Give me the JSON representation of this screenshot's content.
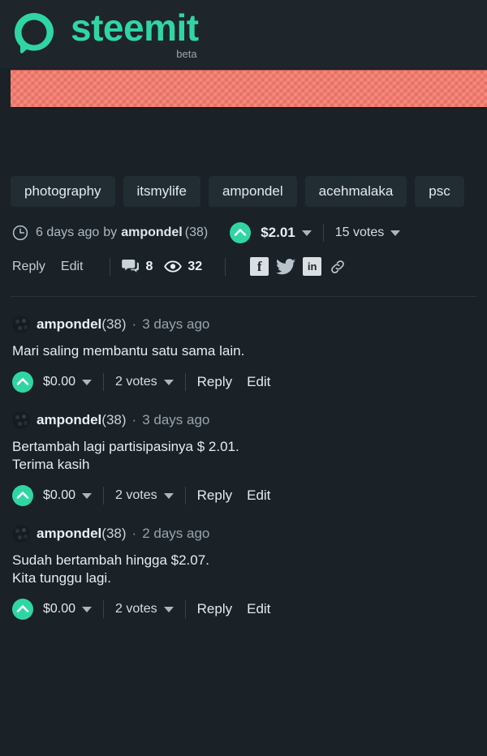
{
  "brand": {
    "name": "steemit",
    "tagline": "beta",
    "logo_icon": "steemit-logo-icon",
    "accent_color": "#2fd6a3",
    "cover_color": "#f4796b"
  },
  "post": {
    "tags": [
      "photography",
      "itsmylife",
      "ampondel",
      "acehmalaka",
      "psc"
    ],
    "meta": {
      "clock_icon": "clock-icon",
      "time": "6 days ago",
      "by": "by",
      "author": "ampondel",
      "reputation": "(38)",
      "upvote_icon": "upvote-chevron-icon",
      "payout": "$2.01",
      "payout_caret_icon": "chevron-down-icon",
      "votes": "15 votes",
      "votes_caret_icon": "chevron-down-icon"
    },
    "actions": {
      "reply": "Reply",
      "edit": "Edit",
      "comment_icon": "comment-bubble-icon",
      "comment_count": "8",
      "views_icon": "eye-icon",
      "views_count": "32",
      "share": [
        {
          "icon": "facebook-icon",
          "label": "f"
        },
        {
          "icon": "twitter-icon",
          "label": ""
        },
        {
          "icon": "linkedin-icon",
          "label": "in"
        },
        {
          "icon": "link-icon",
          "label": ""
        }
      ]
    }
  },
  "comments": [
    {
      "avatar_icon": "avatar-icon",
      "author": "ampondel",
      "reputation": "(38)",
      "separator": "·",
      "time": "3 days ago",
      "lines": [
        "Mari saling membantu satu sama lain."
      ],
      "upvote_icon": "upvote-chevron-icon",
      "payout": "$0.00",
      "payout_caret_icon": "chevron-down-icon",
      "votes": "2 votes",
      "votes_caret_icon": "chevron-down-icon",
      "reply": "Reply",
      "edit": "Edit"
    },
    {
      "avatar_icon": "avatar-icon",
      "author": "ampondel",
      "reputation": "(38)",
      "separator": "·",
      "time": "3 days ago",
      "lines": [
        "Bertambah lagi partisipasinya $ 2.01.",
        "Terima kasih"
      ],
      "upvote_icon": "upvote-chevron-icon",
      "payout": "$0.00",
      "payout_caret_icon": "chevron-down-icon",
      "votes": "2 votes",
      "votes_caret_icon": "chevron-down-icon",
      "reply": "Reply",
      "edit": "Edit"
    },
    {
      "avatar_icon": "avatar-icon",
      "author": "ampondel",
      "reputation": "(38)",
      "separator": "·",
      "time": "2 days ago",
      "lines": [
        "Sudah bertambah hingga $2.07.",
        "Kita tunggu lagi."
      ],
      "upvote_icon": "upvote-chevron-icon",
      "payout": "$0.00",
      "payout_caret_icon": "chevron-down-icon",
      "votes": "2 votes",
      "votes_caret_icon": "chevron-down-icon",
      "reply": "Reply",
      "edit": "Edit"
    }
  ]
}
